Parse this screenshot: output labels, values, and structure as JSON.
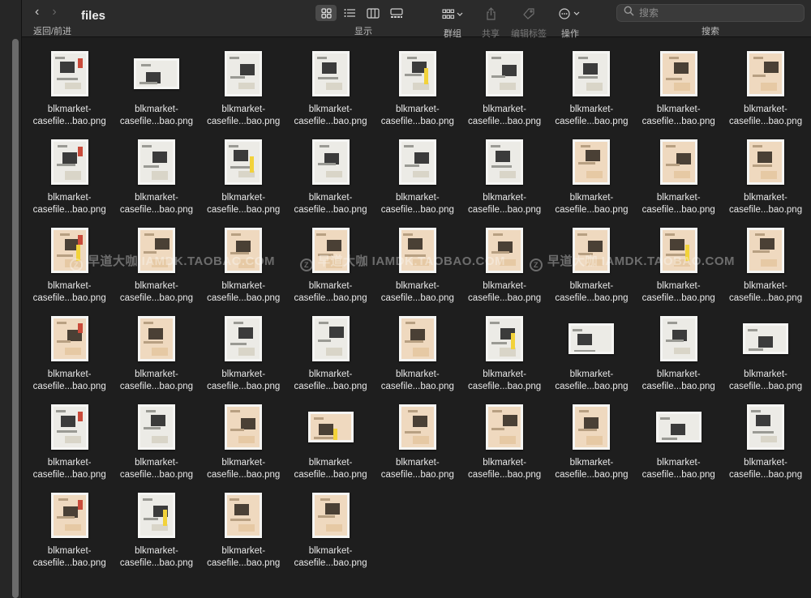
{
  "window": {
    "title": "files",
    "nav_label": "返回/前进"
  },
  "toolbar": {
    "view_label": "显示",
    "group_label": "群组",
    "share_label": "共享",
    "tags_label": "编辑标签",
    "action_label": "操作",
    "search_label": "搜索",
    "search_placeholder": "搜索"
  },
  "icons": {
    "back": "chevron-left-icon",
    "forward": "chevron-right-icon",
    "icon_view": "grid-view-icon",
    "list_view": "list-view-icon",
    "column_view": "column-view-icon",
    "gallery_view": "gallery-view-icon",
    "group": "group-icon",
    "share": "share-icon",
    "tag": "tag-icon",
    "action": "ellipsis-circle-icon",
    "search": "search-icon"
  },
  "watermark": {
    "logo": "Z",
    "text": "早道大咖  IAMDK.TAOBAO.COM"
  },
  "files": [
    {
      "line1": "blkmarket-",
      "line2": "casefile...bao.png",
      "shape": "p",
      "tone": "white"
    },
    {
      "line1": "blkmarket-",
      "line2": "casefile...bao.png",
      "shape": "l",
      "tone": "white"
    },
    {
      "line1": "blkmarket-",
      "line2": "casefile...bao.png",
      "shape": "p",
      "tone": "white"
    },
    {
      "line1": "blkmarket-",
      "line2": "casefile...bao.png",
      "shape": "p",
      "tone": "white"
    },
    {
      "line1": "blkmarket-",
      "line2": "casefile...bao.png",
      "shape": "p",
      "tone": "white"
    },
    {
      "line1": "blkmarket-",
      "line2": "casefile...bao.png",
      "shape": "p",
      "tone": "white"
    },
    {
      "line1": "blkmarket-",
      "line2": "casefile...bao.png",
      "shape": "p",
      "tone": "white"
    },
    {
      "line1": "blkmarket-",
      "line2": "casefile...bao.png",
      "shape": "p",
      "tone": "beige"
    },
    {
      "line1": "blkmarket-",
      "line2": "casefile...bao.png",
      "shape": "p",
      "tone": "beige"
    },
    {
      "line1": "blkmarket-",
      "line2": "casefile...bao.png",
      "shape": "p",
      "tone": "white"
    },
    {
      "line1": "blkmarket-",
      "line2": "casefile...bao.png",
      "shape": "p",
      "tone": "white"
    },
    {
      "line1": "blkmarket-",
      "line2": "casefile...bao.png",
      "shape": "p",
      "tone": "white"
    },
    {
      "line1": "blkmarket-",
      "line2": "casefile...bao.png",
      "shape": "p",
      "tone": "white"
    },
    {
      "line1": "blkmarket-",
      "line2": "casefile...bao.png",
      "shape": "p",
      "tone": "white"
    },
    {
      "line1": "blkmarket-",
      "line2": "casefile...bao.png",
      "shape": "p",
      "tone": "white"
    },
    {
      "line1": "blkmarket-",
      "line2": "casefile...bao.png",
      "shape": "p",
      "tone": "beige"
    },
    {
      "line1": "blkmarket-",
      "line2": "casefile...bao.png",
      "shape": "p",
      "tone": "beige"
    },
    {
      "line1": "blkmarket-",
      "line2": "casefile...bao.png",
      "shape": "p",
      "tone": "beige"
    },
    {
      "line1": "blkmarket-",
      "line2": "casefile...bao.png",
      "shape": "p",
      "tone": "beige"
    },
    {
      "line1": "blkmarket-",
      "line2": "casefile...bao.png",
      "shape": "p",
      "tone": "beige"
    },
    {
      "line1": "blkmarket-",
      "line2": "casefile...bao.png",
      "shape": "p",
      "tone": "beige"
    },
    {
      "line1": "blkmarket-",
      "line2": "casefile...bao.png",
      "shape": "p",
      "tone": "beige"
    },
    {
      "line1": "blkmarket-",
      "line2": "casefile...bao.png",
      "shape": "p",
      "tone": "beige"
    },
    {
      "line1": "blkmarket-",
      "line2": "casefile...bao.png",
      "shape": "p",
      "tone": "beige"
    },
    {
      "line1": "blkmarket-",
      "line2": "casefile...bao.png",
      "shape": "p",
      "tone": "beige"
    },
    {
      "line1": "blkmarket-",
      "line2": "casefile...bao.png",
      "shape": "p",
      "tone": "beige"
    },
    {
      "line1": "blkmarket-",
      "line2": "casefile...bao.png",
      "shape": "p",
      "tone": "beige"
    },
    {
      "line1": "blkmarket-",
      "line2": "casefile...bao.png",
      "shape": "p",
      "tone": "beige"
    },
    {
      "line1": "blkmarket-",
      "line2": "casefile...bao.png",
      "shape": "p",
      "tone": "beige"
    },
    {
      "line1": "blkmarket-",
      "line2": "casefile...bao.png",
      "shape": "p",
      "tone": "white"
    },
    {
      "line1": "blkmarket-",
      "line2": "casefile...bao.png",
      "shape": "p",
      "tone": "white"
    },
    {
      "line1": "blkmarket-",
      "line2": "casefile...bao.png",
      "shape": "p",
      "tone": "beige"
    },
    {
      "line1": "blkmarket-",
      "line2": "casefile...bao.png",
      "shape": "p",
      "tone": "white"
    },
    {
      "line1": "blkmarket-",
      "line2": "casefile...bao.png",
      "shape": "l",
      "tone": "white"
    },
    {
      "line1": "blkmarket-",
      "line2": "casefile...bao.png",
      "shape": "p",
      "tone": "white"
    },
    {
      "line1": "blkmarket-",
      "line2": "casefile...bao.png",
      "shape": "l",
      "tone": "white"
    },
    {
      "line1": "blkmarket-",
      "line2": "casefile...bao.png",
      "shape": "p",
      "tone": "white"
    },
    {
      "line1": "blkmarket-",
      "line2": "casefile...bao.png",
      "shape": "p",
      "tone": "white"
    },
    {
      "line1": "blkmarket-",
      "line2": "casefile...bao.png",
      "shape": "p",
      "tone": "beige"
    },
    {
      "line1": "blkmarket-",
      "line2": "casefile...bao.png",
      "shape": "l",
      "tone": "beige"
    },
    {
      "line1": "blkmarket-",
      "line2": "casefile...bao.png",
      "shape": "p",
      "tone": "beige"
    },
    {
      "line1": "blkmarket-",
      "line2": "casefile...bao.png",
      "shape": "p",
      "tone": "beige"
    },
    {
      "line1": "blkmarket-",
      "line2": "casefile...bao.png",
      "shape": "p",
      "tone": "beige"
    },
    {
      "line1": "blkmarket-",
      "line2": "casefile...bao.png",
      "shape": "l",
      "tone": "white"
    },
    {
      "line1": "blkmarket-",
      "line2": "casefile...bao.png",
      "shape": "p",
      "tone": "white"
    },
    {
      "line1": "blkmarket-",
      "line2": "casefile...bao.png",
      "shape": "p",
      "tone": "beige"
    },
    {
      "line1": "blkmarket-",
      "line2": "casefile...bao.png",
      "shape": "p",
      "tone": "white"
    },
    {
      "line1": "blkmarket-",
      "line2": "casefile...bao.png",
      "shape": "p",
      "tone": "beige"
    },
    {
      "line1": "blkmarket-",
      "line2": "casefile...bao.png",
      "shape": "p",
      "tone": "beige"
    }
  ]
}
